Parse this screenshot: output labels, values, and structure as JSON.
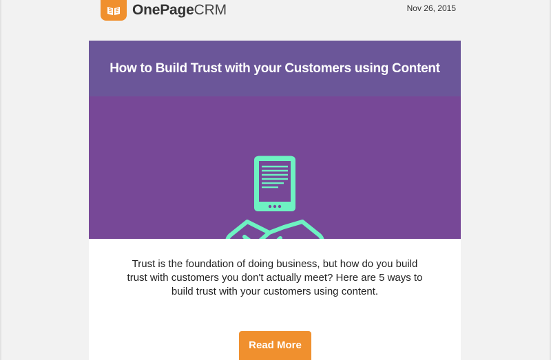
{
  "header": {
    "logo_bold": "OnePage",
    "logo_light": "CRM",
    "logo_icon": "book-icon",
    "date": "Nov 26, 2015"
  },
  "card": {
    "title": "How to Build Trust with your Customers using Content",
    "hero_icons": [
      "tablet-icon",
      "handshake-icon"
    ],
    "body": "Trust is the foundation of doing business, but how do you build trust with customers you don't actually meet? Here are 5 ways to build trust with your customers using content.",
    "cta_label": "Read More"
  },
  "colors": {
    "brand_orange": "#f0902e",
    "title_bar": "#6b5699",
    "hero_bg": "#774897",
    "icon_mint": "#6ef2c2",
    "page_bg": "#f2f2f2"
  }
}
